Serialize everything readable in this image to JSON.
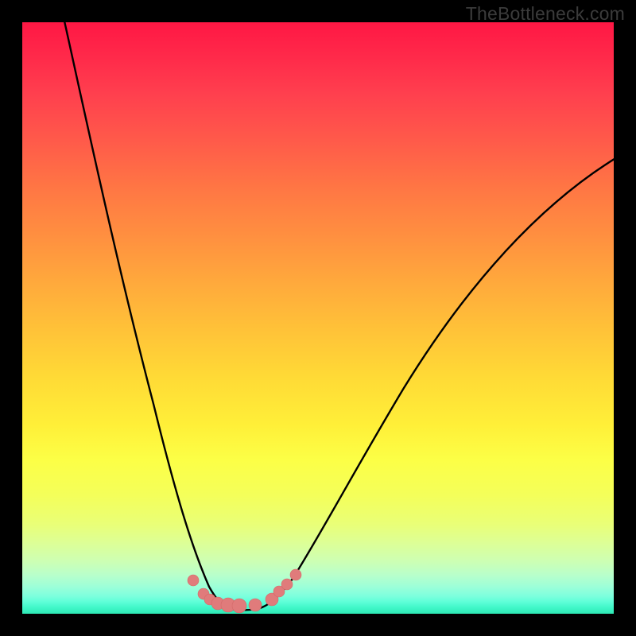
{
  "watermark": {
    "text": "TheBottleneck.com"
  },
  "chart_data": {
    "type": "line",
    "title": "",
    "xlabel": "",
    "ylabel": "",
    "xlim": [
      0,
      1
    ],
    "ylim": [
      0,
      1
    ],
    "series": [
      {
        "name": "bottleneck-curve",
        "x": [
          0.0,
          0.05,
          0.1,
          0.15,
          0.2,
          0.25,
          0.28,
          0.3,
          0.32,
          0.34,
          0.36,
          0.38,
          0.4,
          0.44,
          0.5,
          0.55,
          0.6,
          0.65,
          0.7,
          0.75,
          0.8,
          0.85,
          0.9,
          0.95,
          1.0
        ],
        "y": [
          1.0,
          0.8,
          0.61,
          0.43,
          0.26,
          0.12,
          0.06,
          0.03,
          0.016,
          0.013,
          0.013,
          0.014,
          0.017,
          0.032,
          0.09,
          0.15,
          0.22,
          0.29,
          0.36,
          0.43,
          0.5,
          0.56,
          0.61,
          0.66,
          0.7
        ]
      },
      {
        "name": "markers",
        "x": [
          0.289,
          0.307,
          0.318,
          0.331,
          0.348,
          0.367,
          0.394,
          0.422,
          0.435,
          0.448,
          0.462
        ],
        "y": [
          0.056,
          0.033,
          0.024,
          0.018,
          0.015,
          0.014,
          0.015,
          0.025,
          0.038,
          0.05,
          0.066
        ]
      }
    ],
    "colors": {
      "curve": "#000000",
      "marker_fill": "#e07b7b",
      "marker_stroke": "#d46969",
      "gradient_top": "#ff1744",
      "gradient_bottom": "#2de8b4",
      "frame": "#000000"
    }
  }
}
